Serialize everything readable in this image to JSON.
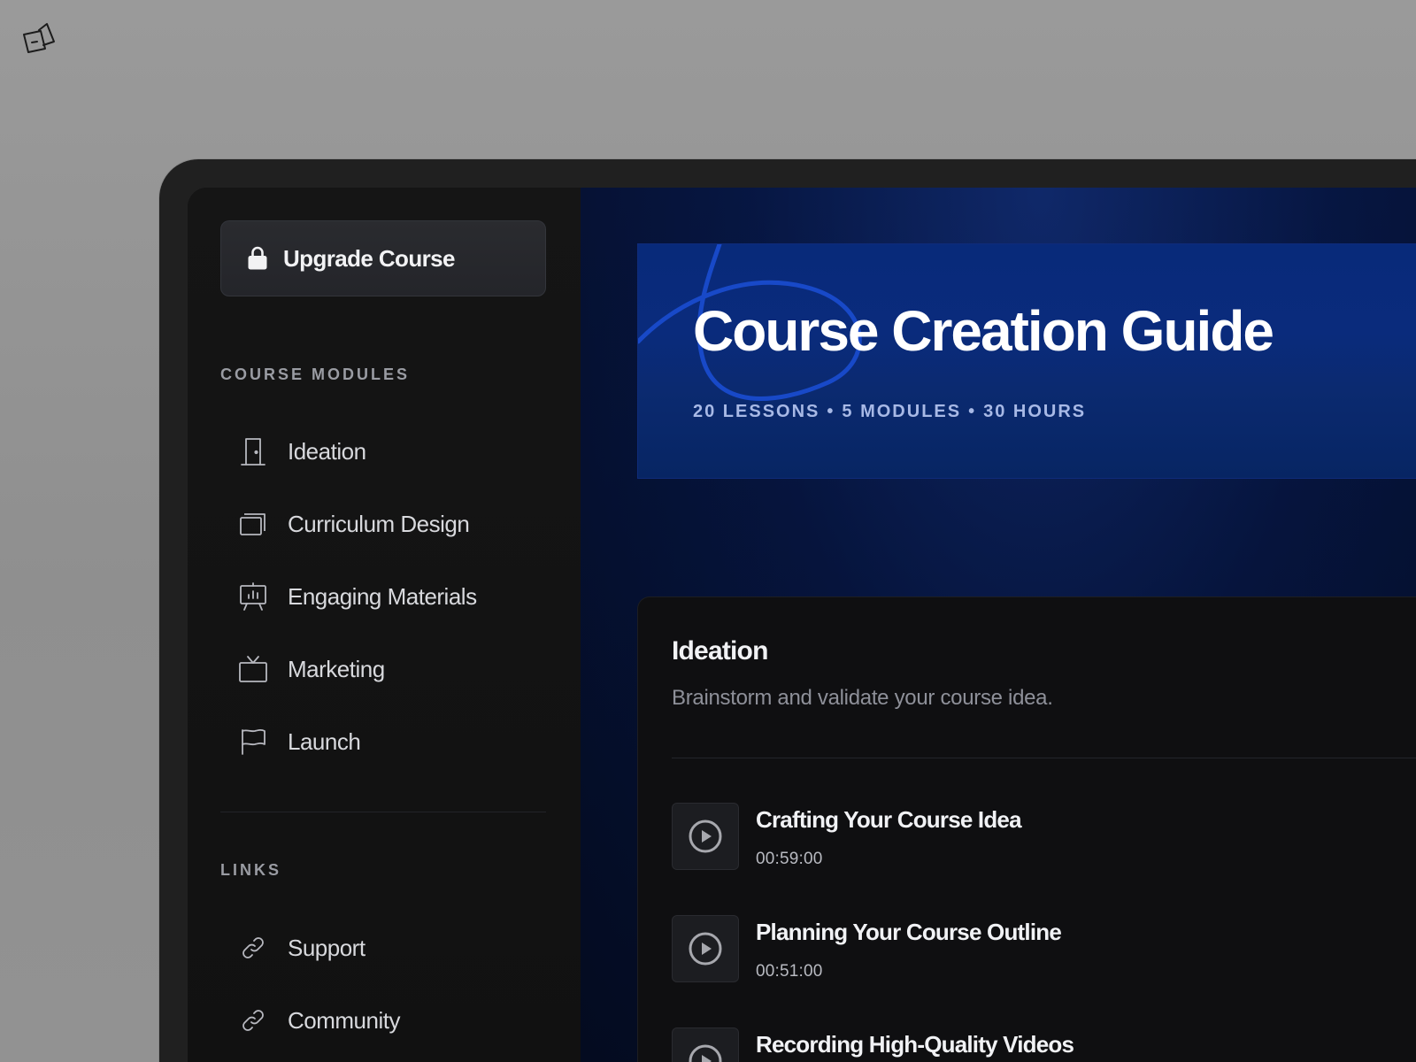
{
  "app": {
    "brand_icon": "logo-icon"
  },
  "sidebar": {
    "upgrade_button": {
      "label": "Upgrade Course",
      "icon": "lock-icon"
    },
    "modules_title": "COURSE MODULES",
    "modules": [
      {
        "label": "Ideation",
        "icon": "door-icon"
      },
      {
        "label": "Curriculum Design",
        "icon": "stack-icon"
      },
      {
        "label": "Engaging Materials",
        "icon": "presentation-icon"
      },
      {
        "label": "Marketing",
        "icon": "tv-icon"
      },
      {
        "label": "Launch",
        "icon": "flag-icon"
      }
    ],
    "links_title": "LINKS",
    "links": [
      {
        "label": "Support",
        "icon": "link-icon"
      },
      {
        "label": "Community",
        "icon": "link-icon"
      }
    ]
  },
  "hero": {
    "title": "Course Creation Guide",
    "meta": {
      "lessons": "20 LESSONS",
      "modules": "5 MODULES",
      "hours": "30 HOURS",
      "separator": "•"
    }
  },
  "module": {
    "title": "Ideation",
    "description": "Brainstorm and validate your course idea.",
    "lessons": [
      {
        "title": "Crafting Your Course Idea",
        "duration": "00:59:00",
        "icon": "play-icon"
      },
      {
        "title": "Planning Your Course Outline",
        "duration": "00:51:00",
        "icon": "play-icon"
      },
      {
        "title": "Recording High-Quality Videos",
        "duration": "",
        "icon": "play-icon"
      }
    ]
  },
  "colors": {
    "background": "#959595",
    "frame": "#202020",
    "sidebar": "#121212",
    "hero_blue": "#0a2b7c",
    "accent_stroke": "#1a49c9",
    "card": "#0f0f11",
    "text_primary": "#f1f2f5",
    "text_secondary": "#8e9099"
  }
}
